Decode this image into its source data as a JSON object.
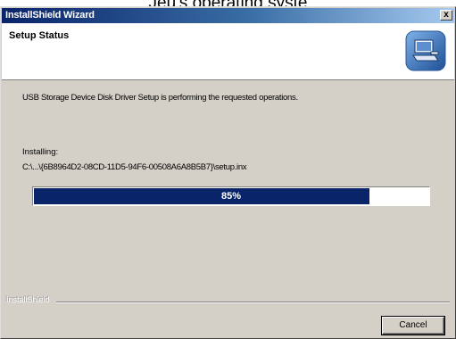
{
  "background_text": "Jeu's operating syste",
  "window": {
    "title": "InstallShield Wizard",
    "close_glyph": "x",
    "titlebar_color": "#0a246a"
  },
  "header": {
    "title": "Setup Status",
    "icon": "computer-setup-icon"
  },
  "body": {
    "description": "USB Storage Device Disk Driver Setup is performing the requested operations.",
    "installing_label": "Installing:",
    "path": "C:\\...\\{6B8964D2-08CD-11D5-94F6-00508A6A8B5B7}\\setup.inx"
  },
  "progress": {
    "percent": 85,
    "label": "85%"
  },
  "footer": {
    "brand": "InstallShield",
    "cancel_label": "Cancel"
  }
}
